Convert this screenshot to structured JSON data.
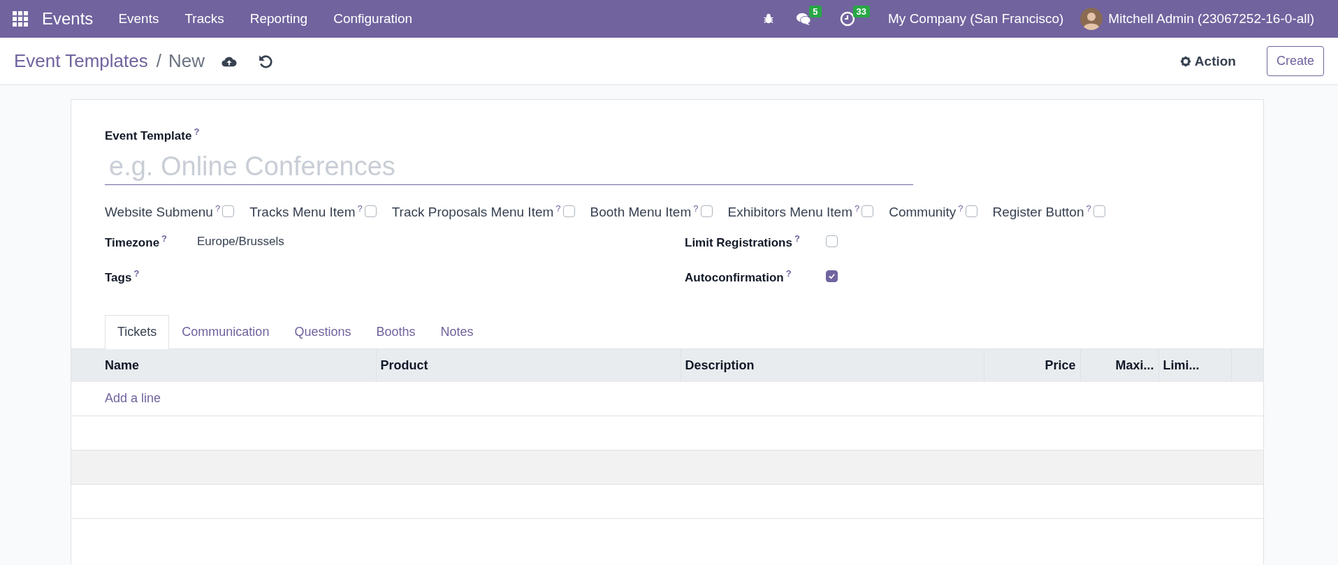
{
  "navbar": {
    "app_name": "Events",
    "menu": [
      "Events",
      "Tracks",
      "Reporting",
      "Configuration"
    ],
    "chat_count": "5",
    "activity_count": "33",
    "company": "My Company (San Francisco)",
    "user": "Mitchell Admin (23067252-16-0-all)"
  },
  "control_panel": {
    "breadcrumb_parent": "Event Templates",
    "breadcrumb_separator": "/",
    "breadcrumb_current": "New",
    "action_button": "Action",
    "create_button": "Create"
  },
  "form": {
    "title_field": {
      "label": "Event Template",
      "help": "?",
      "placeholder": "e.g. Online Conferences"
    },
    "website_options": [
      {
        "label": "Website Submenu",
        "help": "?",
        "checked": false
      },
      {
        "label": "Tracks Menu Item",
        "help": "?",
        "checked": false
      },
      {
        "label": "Track Proposals Menu Item",
        "help": "?",
        "checked": false
      },
      {
        "label": "Booth Menu Item",
        "help": "?",
        "checked": false
      },
      {
        "label": "Exhibitors Menu Item",
        "help": "?",
        "checked": false
      },
      {
        "label": "Community",
        "help": "?",
        "checked": false
      },
      {
        "label": "Register Button",
        "help": "?",
        "checked": false
      }
    ],
    "left_fields": [
      {
        "kind": "text",
        "label": "Timezone",
        "help": "?",
        "value": "Europe/Brussels"
      },
      {
        "kind": "tags",
        "label": "Tags",
        "help": "?"
      }
    ],
    "right_fields": [
      {
        "kind": "checkbox",
        "label": "Limit Registrations",
        "help": "?",
        "checked": false
      },
      {
        "kind": "checkbox",
        "label": "Autoconfirmation",
        "help": "?",
        "checked": true
      }
    ]
  },
  "tabs": [
    {
      "label": "Tickets",
      "selected": true
    },
    {
      "label": "Communication",
      "selected": false
    },
    {
      "label": "Questions",
      "selected": false
    },
    {
      "label": "Booths",
      "selected": false
    },
    {
      "label": "Notes",
      "selected": false
    }
  ],
  "table": {
    "columns": [
      {
        "label": "Name",
        "kind": "text"
      },
      {
        "label": "Product",
        "kind": "text"
      },
      {
        "label": "Description",
        "kind": "text"
      },
      {
        "label": "Price",
        "kind": "number"
      },
      {
        "label": "Maxi...",
        "kind": "number"
      },
      {
        "label": "Limi...",
        "kind": "text"
      }
    ],
    "add_line": "Add a line"
  }
}
